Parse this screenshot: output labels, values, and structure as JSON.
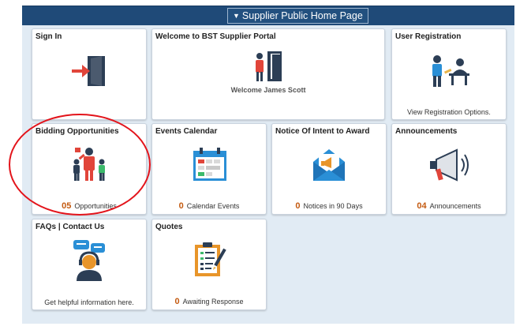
{
  "header": {
    "title": "Supplier Public Home Page"
  },
  "tiles": {
    "sign_in": {
      "title": "Sign In"
    },
    "welcome": {
      "title": "Welcome to BST Supplier Portal",
      "message": "Welcome James Scott"
    },
    "user_registration": {
      "title": "User Registration",
      "footer": "View Registration Options."
    },
    "bidding": {
      "title": "Bidding Opportunities",
      "count": "05",
      "label": "Opportunities"
    },
    "events": {
      "title": "Events Calendar",
      "count": "0",
      "label": "Calendar Events"
    },
    "notice": {
      "title": "Notice Of Intent to Award",
      "count": "0",
      "label": "Notices in 90 Days"
    },
    "announcements": {
      "title": "Announcements",
      "count": "04",
      "label": "Announcements"
    },
    "faqs": {
      "title": "FAQs | Contact Us",
      "footer": "Get helpful information here."
    },
    "quotes": {
      "title": "Quotes",
      "count": "0",
      "label": "Awaiting Response"
    }
  },
  "icons": {
    "sign_in": "sign-in-door-icon",
    "welcome": "person-door-icon",
    "user_registration": "registration-people-icon",
    "bidding": "bidding-people-icon",
    "events": "calendar-icon",
    "notice": "envelope-megaphone-icon",
    "announcements": "megaphone-icon",
    "faqs": "support-agent-icon",
    "quotes": "clipboard-pencil-icon"
  },
  "colors": {
    "banner": "#1f4a78",
    "canvas": "#e1ebf4",
    "count": "#c45a10",
    "highlight": "#e3141b"
  }
}
